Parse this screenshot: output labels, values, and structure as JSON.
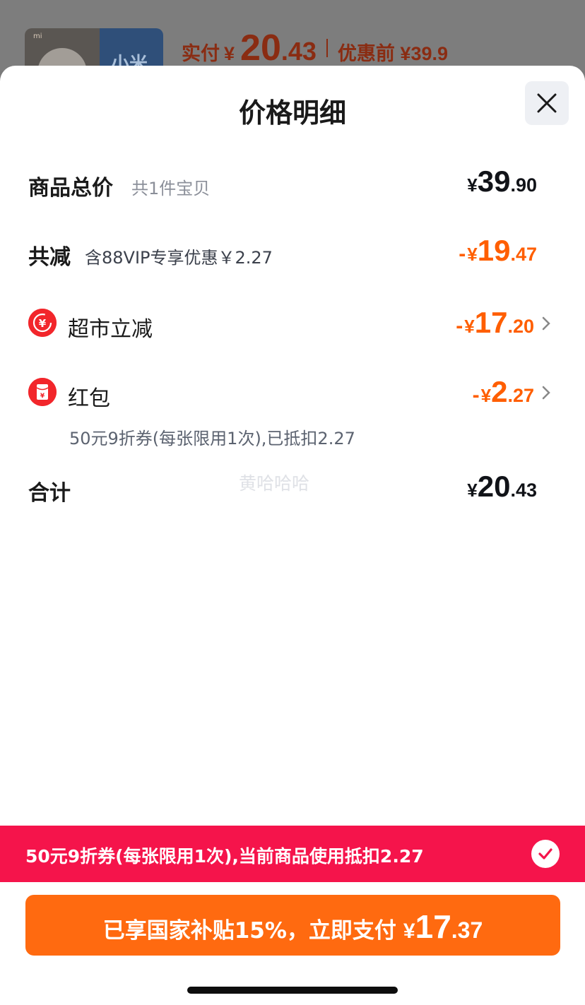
{
  "background": {
    "thumbnail_brand": "小米",
    "thumbnail_logo": "mi",
    "price_label": "实付",
    "price_currency": "¥",
    "price_int": "20",
    "price_dec": ".43",
    "original_label": "优惠前 ¥39.9"
  },
  "sheet": {
    "title": "价格明细",
    "close_icon": "close-icon"
  },
  "rows": {
    "total": {
      "label": "商品总价",
      "sub": "共1件宝贝",
      "currency": "¥",
      "int": "39",
      "dec": ".90"
    },
    "discount": {
      "label": "共减",
      "sub": "含88VIP专享优惠￥2.27",
      "minus": "-",
      "currency": "¥",
      "int": "19",
      "dec": ".47"
    },
    "supermarket": {
      "label": "超市立减",
      "minus": "-",
      "currency": "¥",
      "int": "17",
      "dec": ".20",
      "icon": "¥"
    },
    "redpacket": {
      "label": "红包",
      "minus": "-",
      "currency": "¥",
      "int": "2",
      "dec": ".27",
      "icon": "¥",
      "note": "50元9折券(每张限用1次),已抵扣2.27"
    },
    "sum": {
      "label": "合计",
      "currency": "¥",
      "int": "20",
      "dec": ".43"
    }
  },
  "watermark": "黄哈哈哈",
  "promo_bar": {
    "text": "50元9折券(每张限用1次),当前商品使用抵扣2.27"
  },
  "pay_button": {
    "label": "已享国家补贴15%，立即支付",
    "currency": "¥",
    "int": "17",
    "dec": ".37"
  },
  "colors": {
    "accent_orange": "#ff5e00",
    "promo_red": "#f5144b",
    "button_orange": "#ff6a10"
  }
}
